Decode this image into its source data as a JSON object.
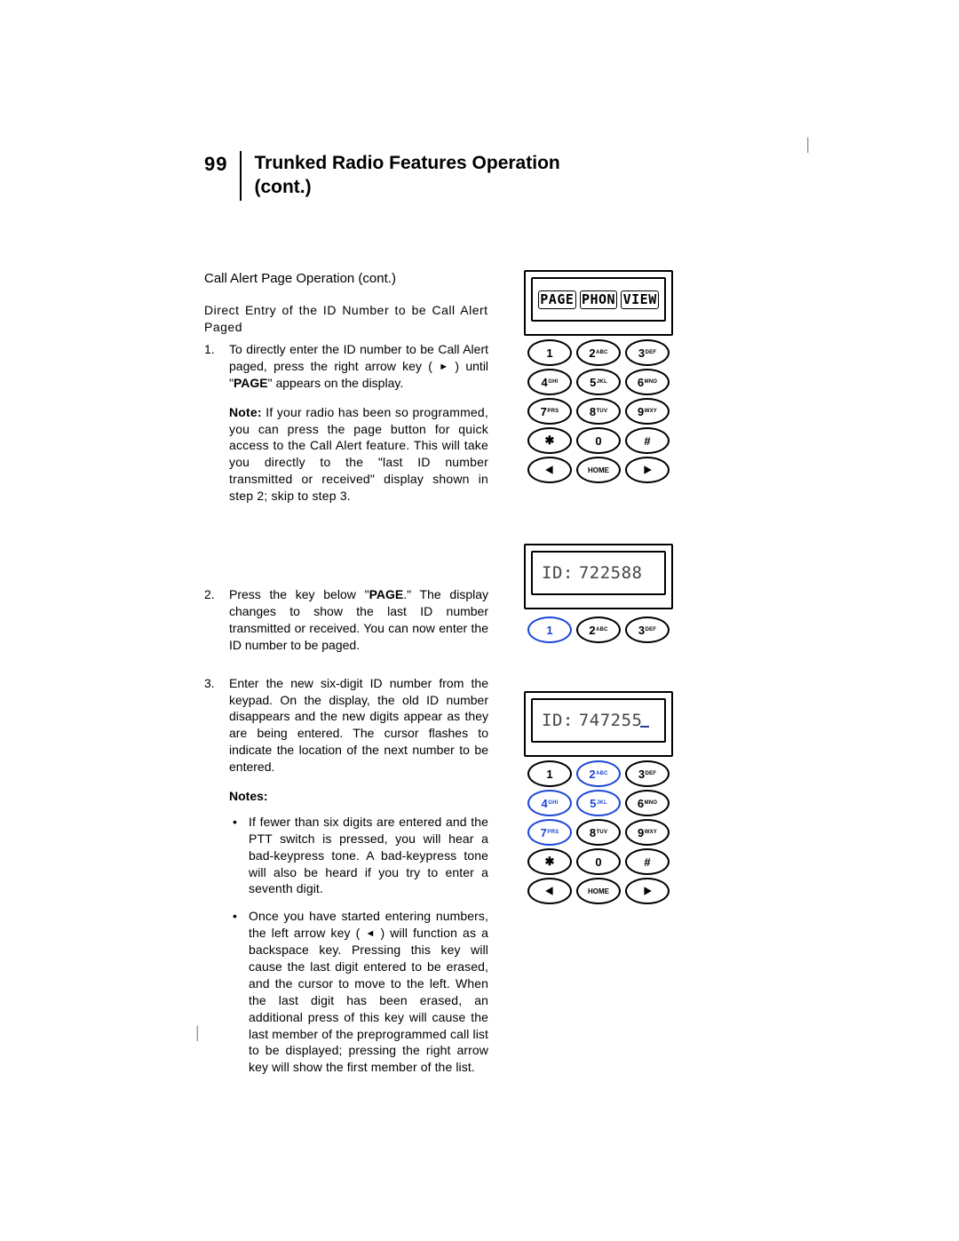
{
  "page_number": "99",
  "title_line1": "Trunked Radio Features Operation",
  "title_line2": "(cont.)",
  "subheading": "Call Alert Page Operation (cont.)",
  "intro": "Direct Entry of the ID Number to be Call Alert Paged",
  "step1_num": "1.",
  "step1_a": "To directly enter the ID number to be Call Alert paged, press the right arrow key (",
  "step1_b": ") until \"",
  "step1_page": "PAGE",
  "step1_c": "\" appears on the display.",
  "note1_prefix": "Note:",
  "note1_body": " If your radio has been so programmed, you can press the page button for quick access to the Call Alert feature. This will take you directly to the \"last ID number transmitted or received\" display shown in step 2; skip to step 3.",
  "step2_num": "2.",
  "step2_a": "Press the key below \"",
  "step2_page": "PAGE",
  "step2_b": ".\" The display changes to show the last ID number transmitted or received. You can now enter the ID number to be paged.",
  "step3_num": "3.",
  "step3_body": "Enter the new six-digit ID number from the keypad. On the display, the old ID number disappears and the new digits appear as they are being entered. The cursor flashes to indicate the location of the next number to be entered.",
  "notes_heading": "Notes:",
  "bullet1": "If fewer than six digits are entered and the PTT switch is pressed, you will hear a bad-keypress tone. A bad-keypress tone will also be heard if you try to enter a seventh digit.",
  "bullet2_a": "Once you have started entering numbers, the left arrow key (",
  "bullet2_b": ") will function as a backspace key. Pressing this key will cause the last digit entered to be erased, and the cursor to move to the left. When the last digit has been erased, an additional press of this key will cause the last member of the preprogrammed call list to be displayed; pressing the right arrow key will show the first member of the list.",
  "softkeys": {
    "page": "PAGE",
    "phon": "PHON",
    "view": "VIEW"
  },
  "keys": {
    "k1": "1",
    "k2": "2",
    "k2s": "ABC",
    "k3": "3",
    "k3s": "DEF",
    "k4": "4",
    "k4s": "GHI",
    "k5": "5",
    "k5s": "JKL",
    "k6": "6",
    "k6s": "MNO",
    "k7": "7",
    "k7s": "PRS",
    "k8": "8",
    "k8s": "TUV",
    "k9": "9",
    "k9s": "WXY",
    "kstar": "✱",
    "k0": "0",
    "khash": "#",
    "home": "HOME"
  },
  "id1_label": "ID:",
  "id1_value": "722588",
  "id2_label": "ID:",
  "id2_value": "747255"
}
